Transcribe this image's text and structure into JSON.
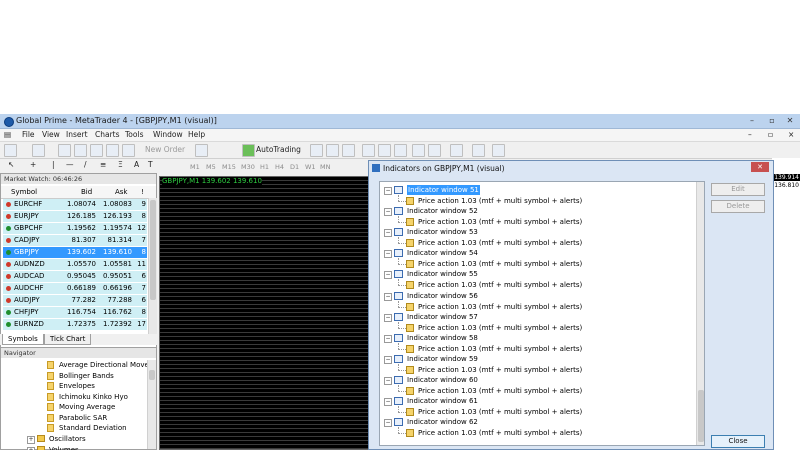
{
  "window": {
    "title": "Global Prime - MetaTrader 4 - [GBPJPY,M1 (visual)]"
  },
  "menu": [
    "File",
    "View",
    "Insert",
    "Charts",
    "Tools",
    "Window",
    "Help"
  ],
  "toolbar": {
    "new_order": "New Order",
    "autotrading": "AutoTrading",
    "timeframes": [
      "M1",
      "M5",
      "M15",
      "M30",
      "H1",
      "H4",
      "D1",
      "W1",
      "MN"
    ]
  },
  "market_watch": {
    "header": "Market Watch: 06:46:26",
    "columns": {
      "symbol": "Symbol",
      "bid": "Bid",
      "ask": "Ask",
      "spread": "!"
    },
    "rows": [
      {
        "symbol": "EURCHF",
        "bid": "1.08074",
        "ask": "1.08083",
        "spread": "9",
        "dir": "down"
      },
      {
        "symbol": "EURJPY",
        "bid": "126.185",
        "ask": "126.193",
        "spread": "8",
        "dir": "down"
      },
      {
        "symbol": "GBPCHF",
        "bid": "1.19562",
        "ask": "1.19574",
        "spread": "12",
        "dir": "up"
      },
      {
        "symbol": "CADJPY",
        "bid": "81.307",
        "ask": "81.314",
        "spread": "7",
        "dir": "down"
      },
      {
        "symbol": "GBPJPY",
        "bid": "139.602",
        "ask": "139.610",
        "spread": "8",
        "dir": "up",
        "selected": true
      },
      {
        "symbol": "AUDNZD",
        "bid": "1.05570",
        "ask": "1.05581",
        "spread": "11",
        "dir": "down"
      },
      {
        "symbol": "AUDCAD",
        "bid": "0.95045",
        "ask": "0.95051",
        "spread": "6",
        "dir": "down"
      },
      {
        "symbol": "AUDCHF",
        "bid": "0.66189",
        "ask": "0.66196",
        "spread": "7",
        "dir": "down"
      },
      {
        "symbol": "AUDJPY",
        "bid": "77.282",
        "ask": "77.288",
        "spread": "6",
        "dir": "down"
      },
      {
        "symbol": "CHFJPY",
        "bid": "116.754",
        "ask": "116.762",
        "spread": "8",
        "dir": "up"
      },
      {
        "symbol": "EURNZD",
        "bid": "1.72375",
        "ask": "1.72392",
        "spread": "17",
        "dir": "up"
      }
    ],
    "tabs": [
      "Symbols",
      "Tick Chart"
    ]
  },
  "navigator": {
    "header": "Navigator",
    "indicators": [
      "Average Directional Movem",
      "Bollinger Bands",
      "Envelopes",
      "Ichimoku Kinko Hyo",
      "Moving Average",
      "Parabolic SAR",
      "Standard Deviation"
    ],
    "folders": [
      "Oscillators",
      "Volumes"
    ]
  },
  "chart": {
    "label": "GBPJPY,M1 139.602 139.610"
  },
  "right_prices": {
    "p1": "139.914",
    "p2": "136.810"
  },
  "dialog": {
    "title": "Indicators on GBPJPY,M1 (visual)",
    "edit_label": "Edit",
    "delete_label": "Delete",
    "close_label": "Close",
    "item_label": "Price action 1.03 (mtf + multi symbol + alerts)",
    "windows": [
      "Indicator window 51",
      "Indicator window 52",
      "Indicator window 53",
      "Indicator window 54",
      "Indicator window 55",
      "Indicator window 56",
      "Indicator window 57",
      "Indicator window 58",
      "Indicator window 59",
      "Indicator window 60",
      "Indicator window 61",
      "Indicator window 62"
    ]
  },
  "colors": {
    "up": "#1e8f2e",
    "down": "#d0392b",
    "selected": "#3399ff",
    "row_bg": "#cfeff5"
  }
}
